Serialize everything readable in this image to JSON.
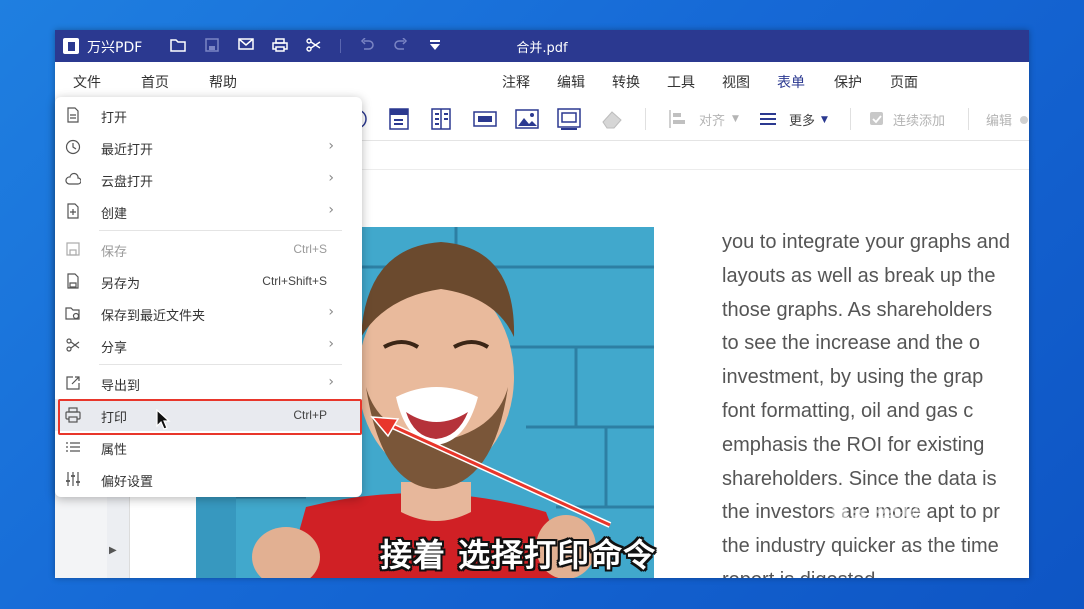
{
  "app": {
    "name": "万兴PDF",
    "doc_title": "合并.pdf"
  },
  "titlebar": {
    "icons": [
      "folder-icon",
      "save-icon",
      "mail-icon",
      "print-icon",
      "scissors-icon",
      "undo-icon",
      "redo-icon",
      "dropdown-icon"
    ]
  },
  "menubar": {
    "left": [
      "文件",
      "首页",
      "帮助"
    ],
    "right": [
      "注释",
      "编辑",
      "转换",
      "工具",
      "视图",
      "表单",
      "保护",
      "页面"
    ],
    "active": "表单"
  },
  "toolbar": {
    "align_label": "对齐",
    "more_label": "更多",
    "continuous_add_label": "连续添加",
    "edit_label": "编辑"
  },
  "file_menu": {
    "items": [
      {
        "icon": "open-file-icon",
        "label": "打开",
        "shortcut": "",
        "arrow": false,
        "disabled": false
      },
      {
        "icon": "clock-icon",
        "label": "最近打开",
        "shortcut": "",
        "arrow": true,
        "disabled": false
      },
      {
        "icon": "cloud-icon",
        "label": "云盘打开",
        "shortcut": "",
        "arrow": true,
        "disabled": false
      },
      {
        "icon": "new-file-icon",
        "label": "创建",
        "shortcut": "",
        "arrow": true,
        "disabled": false
      },
      {
        "icon": "save-icon",
        "label": "保存",
        "shortcut": "Ctrl+S",
        "arrow": false,
        "disabled": true
      },
      {
        "icon": "save-as-icon",
        "label": "另存为",
        "shortcut": "Ctrl+Shift+S",
        "arrow": false,
        "disabled": false
      },
      {
        "icon": "folder-save-icon",
        "label": "保存到最近文件夹",
        "shortcut": "",
        "arrow": true,
        "disabled": false
      },
      {
        "icon": "share-icon",
        "label": "分享",
        "shortcut": "",
        "arrow": true,
        "disabled": false
      },
      {
        "icon": "export-icon",
        "label": "导出到",
        "shortcut": "",
        "arrow": true,
        "disabled": false
      },
      {
        "icon": "print-icon",
        "label": "打印",
        "shortcut": "Ctrl+P",
        "arrow": false,
        "disabled": false
      },
      {
        "icon": "list-icon",
        "label": "属性",
        "shortcut": "",
        "arrow": false,
        "disabled": false
      },
      {
        "icon": "sliders-icon",
        "label": "偏好设置",
        "shortcut": "",
        "arrow": false,
        "disabled": false
      }
    ]
  },
  "document": {
    "lines": [
      "you to integrate your graphs and",
      "layouts as well as break up the",
      "those graphs. As shareholders",
      "to see the increase and the o",
      "investment, by using the grap",
      "font formatting, oil and gas c",
      "emphasis the ROI for existing",
      "shareholders. Since the data is",
      "the investors are more apt to pr",
      "the industry quicker as the time",
      "report is digested."
    ]
  },
  "overlay": {
    "caption": "接着 选择打印命令",
    "watermark": "Bai经验",
    "watermark_url": "jingyan.baidu.com"
  },
  "colors": {
    "brand": "#2b3990",
    "highlight_box": "#e8362b",
    "desktop": "#1669d6"
  }
}
